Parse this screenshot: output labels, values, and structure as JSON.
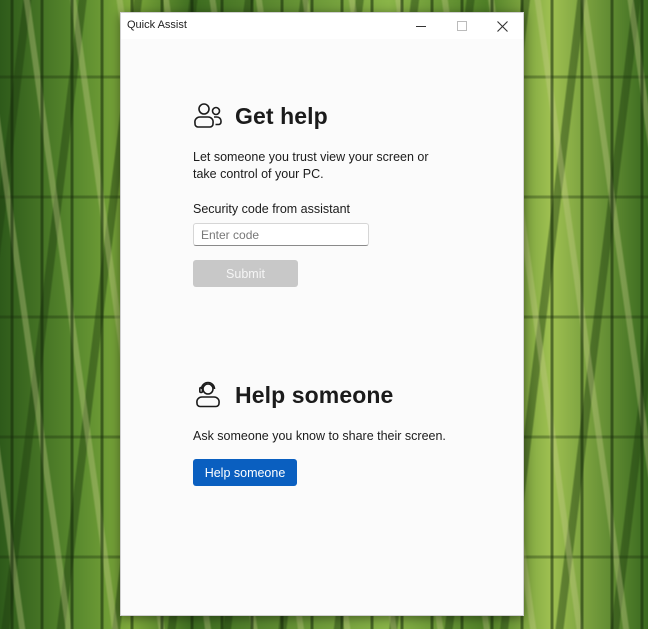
{
  "window": {
    "title": "Quick Assist"
  },
  "get_help": {
    "heading": "Get help",
    "icon": "people-icon",
    "description": "Let someone you trust view your screen or take control of your PC.",
    "field_label": "Security code from assistant",
    "code_value": "",
    "code_placeholder": "Enter code",
    "submit_label": "Submit"
  },
  "help_someone": {
    "heading": "Help someone",
    "icon": "person-headset-icon",
    "description": "Ask someone you know to share their screen.",
    "button_label": "Help someone"
  },
  "colors": {
    "accent": "#0a5fc0",
    "disabled_button": "#c8c8c8",
    "window_bg": "#fbfbfb"
  }
}
